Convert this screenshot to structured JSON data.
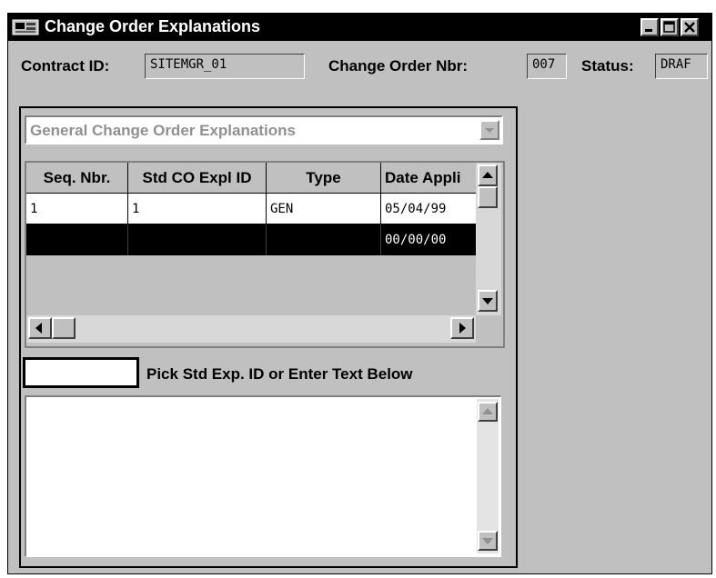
{
  "window": {
    "title": "Change Order Explanations"
  },
  "header": {
    "contract_label": "Contract ID:",
    "contract_value": "SITEMGR_01",
    "co_nbr_label": "Change Order Nbr:",
    "co_nbr_value": "007",
    "status_label": "Status:",
    "status_value": "DRAF"
  },
  "panel": {
    "combo_value": "General Change Order Explanations",
    "table": {
      "columns": [
        "Seq. Nbr.",
        "Std CO Expl ID",
        "Type",
        "Date Appli"
      ],
      "rows": [
        [
          "1",
          "1",
          "GEN",
          "05/04/99"
        ],
        [
          "",
          "",
          "",
          "00/00/00"
        ]
      ],
      "selected_row": 1
    },
    "pick_input_value": "",
    "pick_label": "Pick Std Exp. ID or Enter Text Below",
    "memo_text": ""
  },
  "icons": {
    "app": "app-icon",
    "minimize": "minimize-icon",
    "maximize": "maximize-icon",
    "close": "close-icon",
    "dropdown": "chevron-down-icon",
    "scroll_up": "arrow-up-icon",
    "scroll_down": "arrow-down-icon",
    "scroll_left": "arrow-left-icon",
    "scroll_right": "arrow-right-icon"
  },
  "colors": {
    "titlebar": "#000000",
    "face": "#c0c0c0",
    "selected_row": "#000000"
  }
}
